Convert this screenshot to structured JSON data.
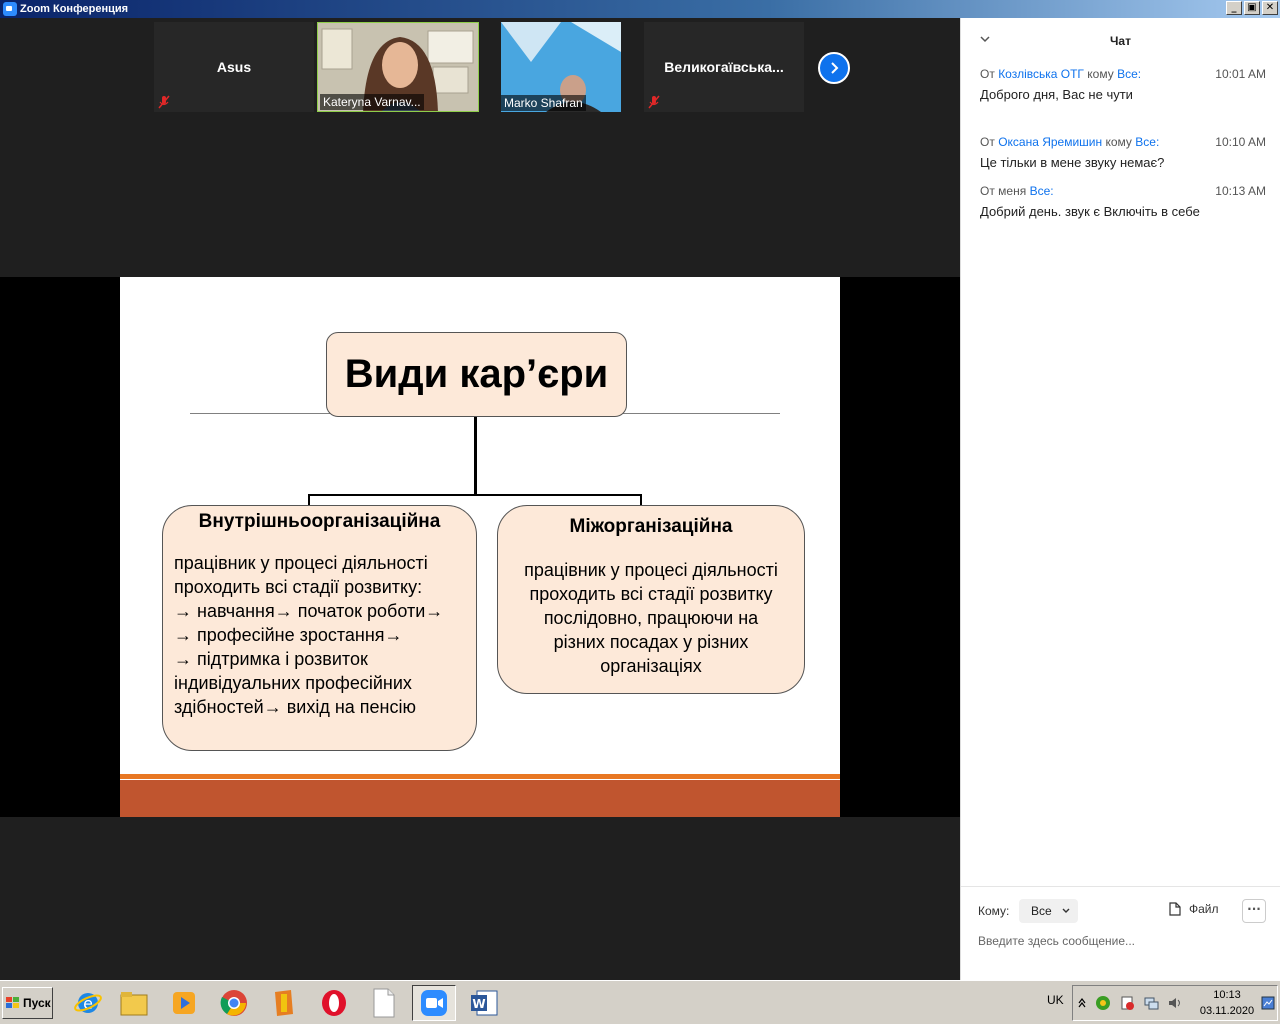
{
  "window": {
    "title": "Zoom Конференция",
    "buttons": [
      "_",
      "▣",
      "✕"
    ]
  },
  "gallery": {
    "participants": [
      {
        "name": "Asus",
        "display": "center",
        "muted": true
      },
      {
        "name": "Kateryna Varnav...",
        "display": "video",
        "muted": false
      },
      {
        "name": "Marko Shafran",
        "display": "video",
        "muted": true
      },
      {
        "name": "Великогаївська...",
        "display": "center",
        "muted": true
      }
    ],
    "next_icon": "chevron-right-icon"
  },
  "slide": {
    "title": "Види кар’єри",
    "left": {
      "heading": "Внутрішньоорганізаційна",
      "body": "працівник у процесі діяльності\nпроходить всі стадії розвитку:\n→ навчання→ початок роботи→\n→ професійне  зростання→\n→ підтримка і розвиток\nіндивідуальних  професійних\nздібностей→ вихід  на пенсію"
    },
    "right": {
      "heading": "Міжорганізаційна",
      "body": "працівник у процесі діяльності\nпроходить всі стадії розвитку\nпослідовно,  працюючи на\nрізних посадах  у різних\nорганізаціях"
    },
    "colors": {
      "box_fill": "#fde9d9",
      "accent_line": "#e87722",
      "footer_band": "#c0552f"
    }
  },
  "chat": {
    "title": "Чат",
    "messages": [
      {
        "from_prefix": "От",
        "from": "Козлівська ОТГ",
        "to_prefix": "кому",
        "to": "Все:",
        "time": "10:01 AM",
        "text": "Доброго дня, Вас не чути"
      },
      {
        "from_prefix": "От",
        "from": "Оксана Яремишин",
        "to_prefix": "кому",
        "to": "Все:",
        "time": "10:10 AM",
        "text": "Це тільки в мене звуку немає?"
      },
      {
        "from_prefix": "От меня",
        "from": "",
        "to_prefix": "",
        "to": "Все:",
        "time": "10:13 AM",
        "text": "Добрий день. звук є Включіть в себе"
      }
    ],
    "to_label": "Кому:",
    "to_value": "Все",
    "file_label": "Файл",
    "more_label": "···",
    "input_placeholder": "Введите здесь сообщение..."
  },
  "taskbar": {
    "start_label": "Пуск",
    "apps": [
      "ie-icon",
      "explorer-folder-icon",
      "media-player-icon",
      "chrome-icon",
      "archive-icon",
      "opera-icon",
      "blank-document-icon",
      "zoom-icon",
      "word-icon"
    ],
    "language": "UK",
    "time": "10:13",
    "date": "03.11.2020"
  }
}
